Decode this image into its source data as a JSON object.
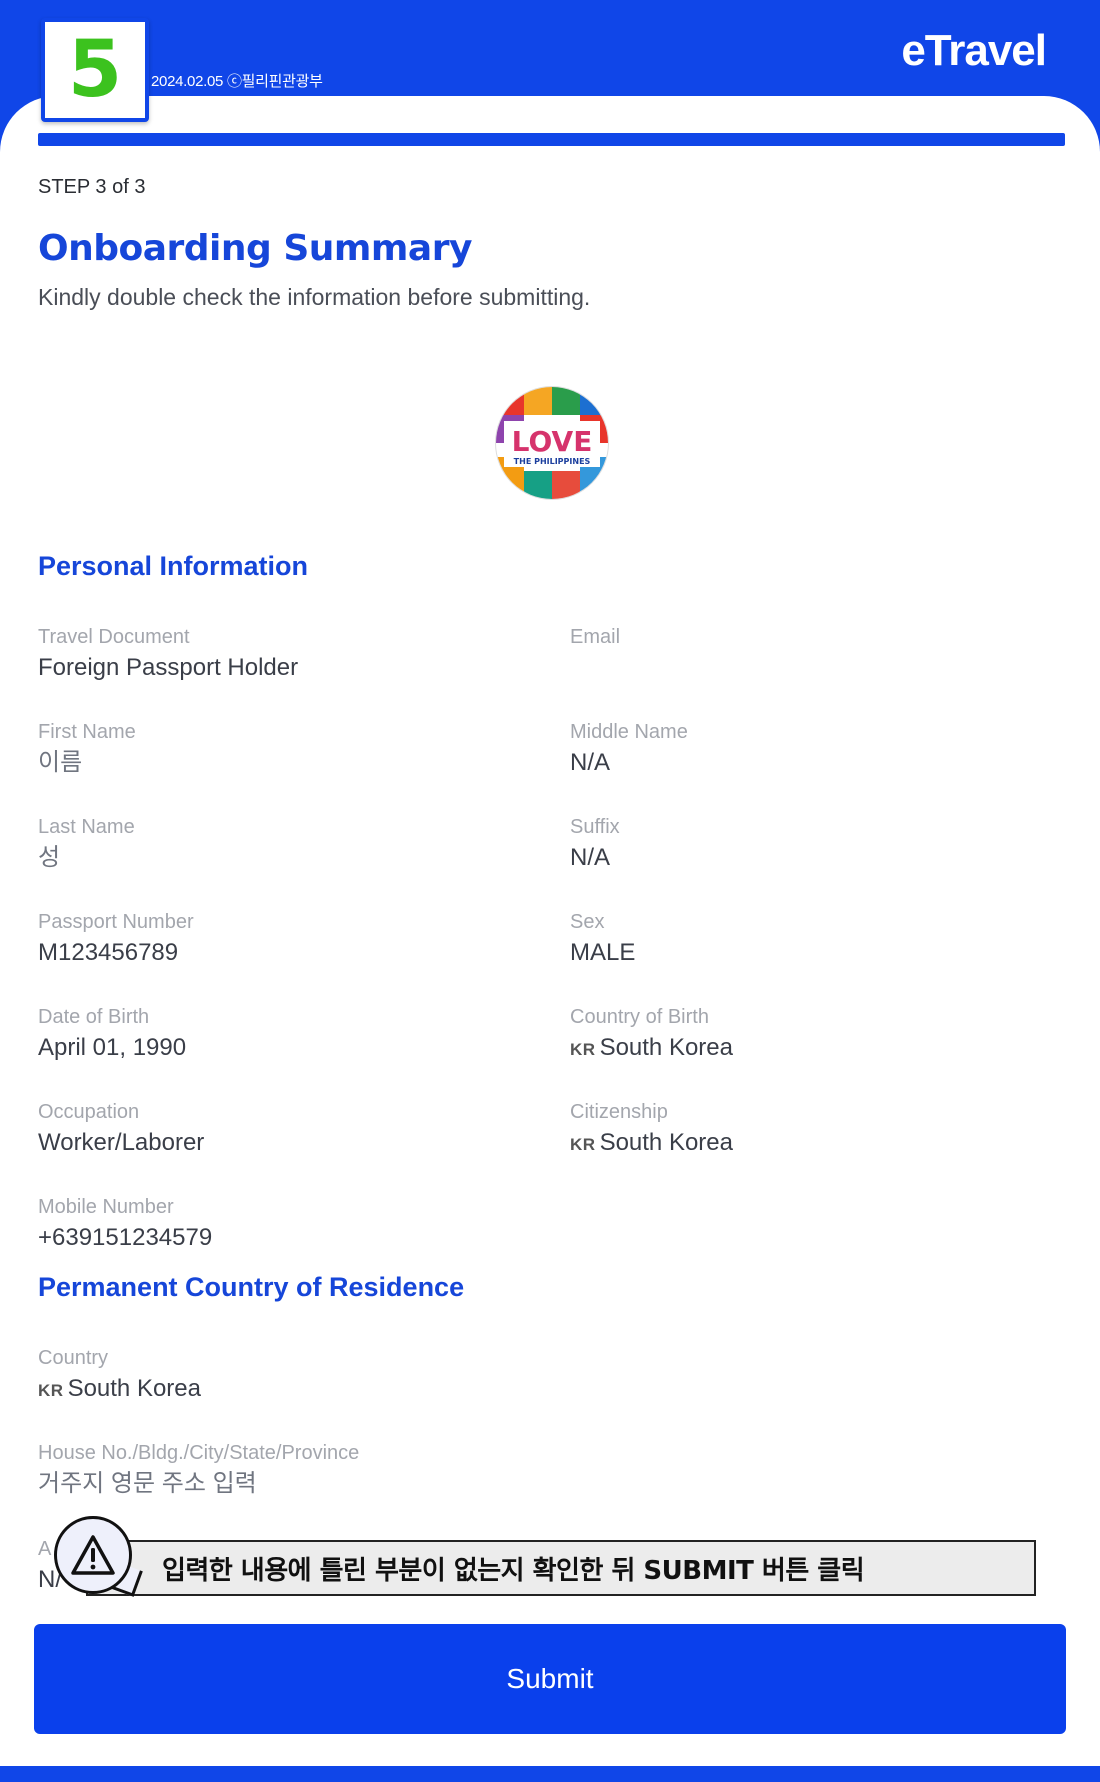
{
  "header": {
    "step_number": "5",
    "date_credit": "2024.02.05 ⓒ필리핀관광부",
    "brand": "eTravel"
  },
  "onboarding": {
    "step_label": "STEP 3 of 3",
    "title": "Onboarding Summary",
    "subtitle": "Kindly double check the information before submitting.",
    "progress": 1.0,
    "logo": {
      "main": "LOVE",
      "sub": "THE PHILIPPINES"
    }
  },
  "personal_information": {
    "title": "Personal Information",
    "fields": {
      "travel_document": {
        "label": "Travel Document",
        "value": "Foreign Passport Holder"
      },
      "email": {
        "label": "Email",
        "value": ""
      },
      "first_name": {
        "label": "First Name",
        "value": "이름"
      },
      "middle_name": {
        "label": "Middle Name",
        "value": "N/A"
      },
      "last_name": {
        "label": "Last Name",
        "value": "성"
      },
      "suffix": {
        "label": "Suffix",
        "value": "N/A"
      },
      "passport_number": {
        "label": "Passport Number",
        "value": "M123456789"
      },
      "sex": {
        "label": "Sex",
        "value": "MALE"
      },
      "date_of_birth": {
        "label": "Date of Birth",
        "value": "April 01, 1990"
      },
      "country_of_birth": {
        "label": "Country of Birth",
        "flag": "KR",
        "value": "South Korea"
      },
      "occupation": {
        "label": "Occupation",
        "value": "Worker/Laborer"
      },
      "citizenship": {
        "label": "Citizenship",
        "flag": "KR",
        "value": "South Korea"
      },
      "mobile_number": {
        "label": "Mobile Number",
        "value": "+639151234579"
      }
    }
  },
  "permanent_residence": {
    "title": "Permanent Country of Residence",
    "fields": {
      "country": {
        "label": "Country",
        "flag": "KR",
        "value": "South Korea"
      },
      "address": {
        "label": "House No./Bldg./City/State/Province",
        "value": "거주지 영문 주소 입력"
      },
      "partial_label": "A",
      "partial_value": "N/"
    }
  },
  "hint": {
    "icon": "warning-icon",
    "text": "입력한 내용에 틀린 부분이 없는지 확인한 뒤 SUBMIT 버튼 클릭"
  },
  "actions": {
    "submit_label": "Submit"
  },
  "colors": {
    "brand_blue": "#1046e8",
    "title_blue": "#1646d9",
    "step_green": "#3cc21e"
  }
}
